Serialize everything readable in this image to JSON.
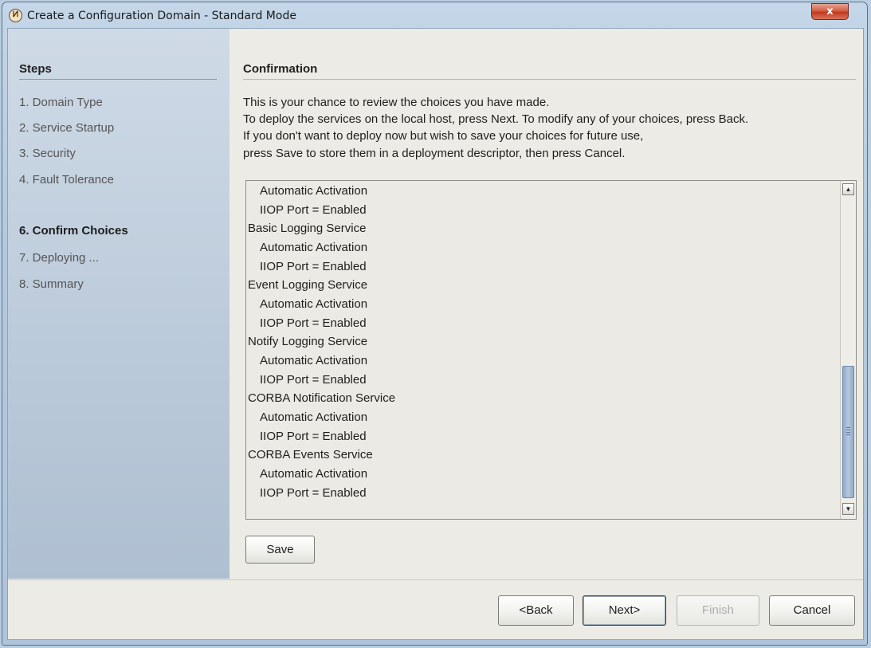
{
  "window": {
    "title": "Create a Configuration Domain - Standard Mode",
    "icon": "network-domain-icon",
    "close_label": "x"
  },
  "steps": {
    "heading": "Steps",
    "items": [
      {
        "label": "1. Domain Type",
        "active": false
      },
      {
        "label": "2. Service Startup",
        "active": false
      },
      {
        "label": "3. Security",
        "active": false
      },
      {
        "label": "4. Fault Tolerance",
        "active": false
      },
      {
        "label": "6. Confirm Choices",
        "active": true
      },
      {
        "label": "7. Deploying ...",
        "active": false
      },
      {
        "label": "8. Summary",
        "active": false
      }
    ]
  },
  "content": {
    "heading": "Confirmation",
    "intro": [
      "This is your chance to review the choices you have made.",
      "To deploy the services on the local host, press Next. To modify any of your choices, press Back.",
      "If you don't want to deploy now but wish to save your choices for future use,",
      "press Save to store them in a deployment descriptor, then press Cancel."
    ],
    "choices": [
      {
        "text": "Automatic Activation",
        "indent": true
      },
      {
        "text": "IIOP Port = Enabled",
        "indent": true
      },
      {
        "text": "Basic Logging Service",
        "indent": false
      },
      {
        "text": "Automatic Activation",
        "indent": true
      },
      {
        "text": "IIOP Port = Enabled",
        "indent": true
      },
      {
        "text": "Event Logging Service",
        "indent": false
      },
      {
        "text": "Automatic Activation",
        "indent": true
      },
      {
        "text": "IIOP Port = Enabled",
        "indent": true
      },
      {
        "text": "Notify Logging Service",
        "indent": false
      },
      {
        "text": "Automatic Activation",
        "indent": true
      },
      {
        "text": "IIOP Port = Enabled",
        "indent": true
      },
      {
        "text": "CORBA Notification Service",
        "indent": false
      },
      {
        "text": "Automatic Activation",
        "indent": true
      },
      {
        "text": "IIOP Port = Enabled",
        "indent": true
      },
      {
        "text": "CORBA Events Service",
        "indent": false
      },
      {
        "text": "Automatic Activation",
        "indent": true
      },
      {
        "text": "IIOP Port = Enabled",
        "indent": true
      }
    ],
    "save_label": "Save"
  },
  "buttons": {
    "back": "<Back",
    "next": "Next>",
    "finish": "Finish",
    "cancel": "Cancel"
  }
}
